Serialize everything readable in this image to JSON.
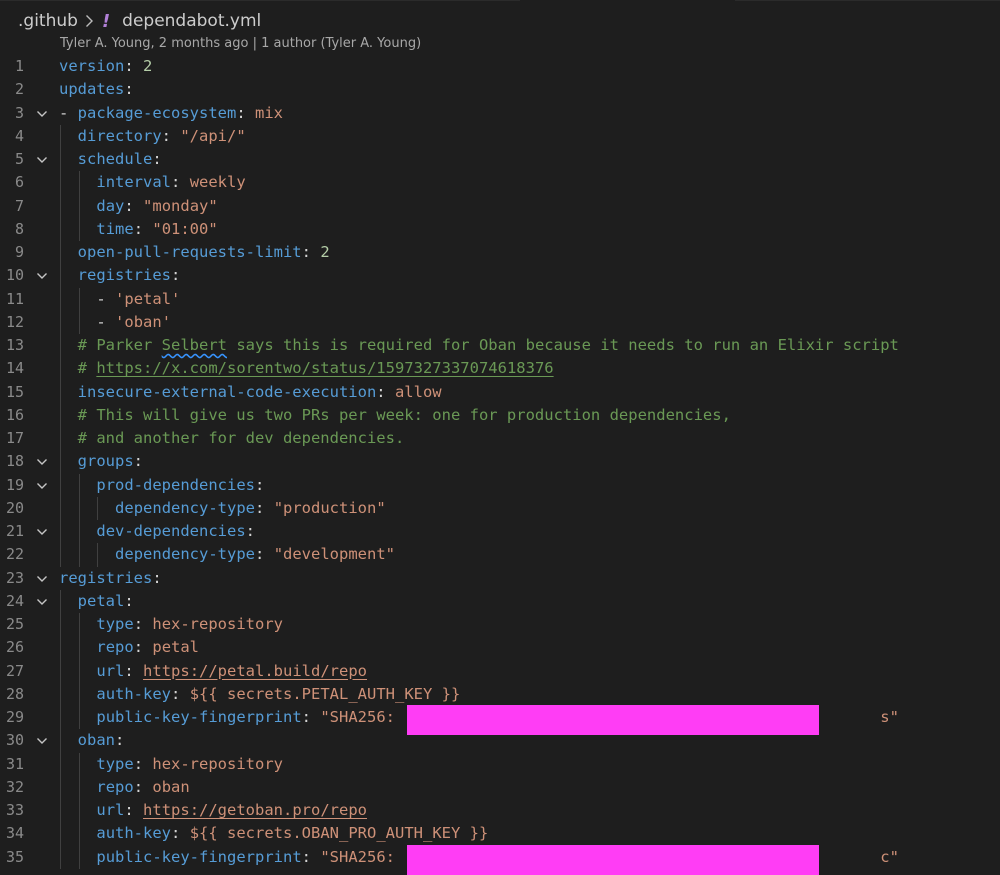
{
  "breadcrumb": {
    "folder": ".github",
    "file": "dependabot.yml"
  },
  "blame": {
    "text": "Tyler A. Young, 2 months ago | 1 author (Tyler A. Young)"
  },
  "colors": {
    "key": "#569cd6",
    "string": "#ce9178",
    "number": "#b5cea8",
    "comment": "#6a9955",
    "redaction": "#ff3df5"
  },
  "lines": [
    {
      "n": "1",
      "fold": false,
      "indent": 0,
      "tokens": [
        [
          "k",
          "version"
        ],
        [
          "p",
          ": "
        ],
        [
          "n",
          "2"
        ]
      ]
    },
    {
      "n": "2",
      "fold": false,
      "indent": 0,
      "tokens": [
        [
          "k",
          "updates"
        ],
        [
          "p",
          ":"
        ]
      ]
    },
    {
      "n": "3",
      "fold": true,
      "indent": 0,
      "tokens": [
        [
          "p",
          "- "
        ],
        [
          "k",
          "package-ecosystem"
        ],
        [
          "p",
          ": "
        ],
        [
          "s",
          "mix"
        ]
      ]
    },
    {
      "n": "4",
      "fold": false,
      "indent": 1,
      "tokens": [
        [
          "k",
          "directory"
        ],
        [
          "p",
          ": "
        ],
        [
          "s",
          "\"/api/\""
        ]
      ]
    },
    {
      "n": "5",
      "fold": true,
      "indent": 1,
      "tokens": [
        [
          "k",
          "schedule"
        ],
        [
          "p",
          ":"
        ]
      ]
    },
    {
      "n": "6",
      "fold": false,
      "indent": 2,
      "tokens": [
        [
          "k",
          "interval"
        ],
        [
          "p",
          ": "
        ],
        [
          "s",
          "weekly"
        ]
      ]
    },
    {
      "n": "7",
      "fold": false,
      "indent": 2,
      "tokens": [
        [
          "k",
          "day"
        ],
        [
          "p",
          ": "
        ],
        [
          "s",
          "\"monday\""
        ]
      ]
    },
    {
      "n": "8",
      "fold": false,
      "indent": 2,
      "tokens": [
        [
          "k",
          "time"
        ],
        [
          "p",
          ": "
        ],
        [
          "s",
          "\"01:00\""
        ]
      ]
    },
    {
      "n": "9",
      "fold": false,
      "indent": 1,
      "tokens": [
        [
          "k",
          "open-pull-requests-limit"
        ],
        [
          "p",
          ": "
        ],
        [
          "n",
          "2"
        ]
      ]
    },
    {
      "n": "10",
      "fold": true,
      "indent": 1,
      "tokens": [
        [
          "k",
          "registries"
        ],
        [
          "p",
          ":"
        ]
      ]
    },
    {
      "n": "11",
      "fold": false,
      "indent": 2,
      "tokens": [
        [
          "p",
          "- "
        ],
        [
          "s",
          "'petal'"
        ]
      ]
    },
    {
      "n": "12",
      "fold": false,
      "indent": 2,
      "tokens": [
        [
          "p",
          "- "
        ],
        [
          "s",
          "'oban'"
        ]
      ]
    },
    {
      "n": "13",
      "fold": false,
      "indent": 1,
      "tokens": [
        [
          "c",
          "# Parker "
        ],
        [
          "c squig",
          "Selbert"
        ],
        [
          "c",
          " says this is required for Oban because it needs to run an Elixir script"
        ]
      ]
    },
    {
      "n": "14",
      "fold": false,
      "indent": 1,
      "tokens": [
        [
          "c",
          "# "
        ],
        [
          "c u",
          "https://x.com/sorentwo/status/1597327337074618376"
        ]
      ]
    },
    {
      "n": "15",
      "fold": false,
      "indent": 1,
      "tokens": [
        [
          "k",
          "insecure-external-code-execution"
        ],
        [
          "p",
          ": "
        ],
        [
          "s",
          "allow"
        ]
      ]
    },
    {
      "n": "16",
      "fold": false,
      "indent": 1,
      "tokens": [
        [
          "c",
          "# This will give us two PRs per week: one for production dependencies,"
        ]
      ]
    },
    {
      "n": "17",
      "fold": false,
      "indent": 1,
      "tokens": [
        [
          "c",
          "# and another for dev dependencies."
        ]
      ]
    },
    {
      "n": "18",
      "fold": true,
      "indent": 1,
      "tokens": [
        [
          "k",
          "groups"
        ],
        [
          "p",
          ":"
        ]
      ]
    },
    {
      "n": "19",
      "fold": true,
      "indent": 2,
      "tokens": [
        [
          "k",
          "prod-dependencies"
        ],
        [
          "p",
          ":"
        ]
      ]
    },
    {
      "n": "20",
      "fold": false,
      "indent": 3,
      "tokens": [
        [
          "k",
          "dependency-type"
        ],
        [
          "p",
          ": "
        ],
        [
          "s",
          "\"production\""
        ]
      ]
    },
    {
      "n": "21",
      "fold": true,
      "indent": 2,
      "tokens": [
        [
          "k",
          "dev-dependencies"
        ],
        [
          "p",
          ":"
        ]
      ]
    },
    {
      "n": "22",
      "fold": false,
      "indent": 3,
      "tokens": [
        [
          "k",
          "dependency-type"
        ],
        [
          "p",
          ": "
        ],
        [
          "s",
          "\"development\""
        ]
      ]
    },
    {
      "n": "23",
      "fold": true,
      "indent": 0,
      "tokens": [
        [
          "k",
          "registries"
        ],
        [
          "p",
          ":"
        ]
      ]
    },
    {
      "n": "24",
      "fold": true,
      "indent": 1,
      "tokens": [
        [
          "k",
          "petal"
        ],
        [
          "p",
          ":"
        ]
      ]
    },
    {
      "n": "25",
      "fold": false,
      "indent": 2,
      "tokens": [
        [
          "k",
          "type"
        ],
        [
          "p",
          ": "
        ],
        [
          "s",
          "hex-repository"
        ]
      ]
    },
    {
      "n": "26",
      "fold": false,
      "indent": 2,
      "tokens": [
        [
          "k",
          "repo"
        ],
        [
          "p",
          ": "
        ],
        [
          "s",
          "petal"
        ]
      ]
    },
    {
      "n": "27",
      "fold": false,
      "indent": 2,
      "tokens": [
        [
          "k",
          "url"
        ],
        [
          "p",
          ": "
        ],
        [
          "s u",
          "https://petal.build/repo"
        ]
      ]
    },
    {
      "n": "28",
      "fold": false,
      "indent": 2,
      "tokens": [
        [
          "k",
          "auth-key"
        ],
        [
          "p",
          ": "
        ],
        [
          "s",
          "${{ secrets.PETAL_AUTH_KEY }}"
        ]
      ]
    },
    {
      "n": "29",
      "fold": false,
      "indent": 2,
      "redact": true,
      "tokens": [
        [
          "k",
          "public-key-fingerprint"
        ],
        [
          "p",
          ": "
        ],
        [
          "s",
          "\"SHA256:"
        ],
        [
          "s",
          "                                                    s\""
        ]
      ]
    },
    {
      "n": "30",
      "fold": true,
      "indent": 1,
      "tokens": [
        [
          "k",
          "oban"
        ],
        [
          "p",
          ":"
        ]
      ]
    },
    {
      "n": "31",
      "fold": false,
      "indent": 2,
      "tokens": [
        [
          "k",
          "type"
        ],
        [
          "p",
          ": "
        ],
        [
          "s",
          "hex-repository"
        ]
      ]
    },
    {
      "n": "32",
      "fold": false,
      "indent": 2,
      "tokens": [
        [
          "k",
          "repo"
        ],
        [
          "p",
          ": "
        ],
        [
          "s",
          "oban"
        ]
      ]
    },
    {
      "n": "33",
      "fold": false,
      "indent": 2,
      "tokens": [
        [
          "k",
          "url"
        ],
        [
          "p",
          ": "
        ],
        [
          "s u",
          "https://getoban.pro/repo"
        ]
      ]
    },
    {
      "n": "34",
      "fold": false,
      "indent": 2,
      "tokens": [
        [
          "k",
          "auth-key"
        ],
        [
          "p",
          ": "
        ],
        [
          "s",
          "${{ secrets.OBAN_PRO_AUTH_KEY }}"
        ]
      ]
    },
    {
      "n": "35",
      "fold": false,
      "indent": 2,
      "redact": true,
      "tokens": [
        [
          "k",
          "public-key-fingerprint"
        ],
        [
          "p",
          ": "
        ],
        [
          "s",
          "\"SHA256:"
        ],
        [
          "s",
          "                                                    c\""
        ]
      ]
    }
  ]
}
